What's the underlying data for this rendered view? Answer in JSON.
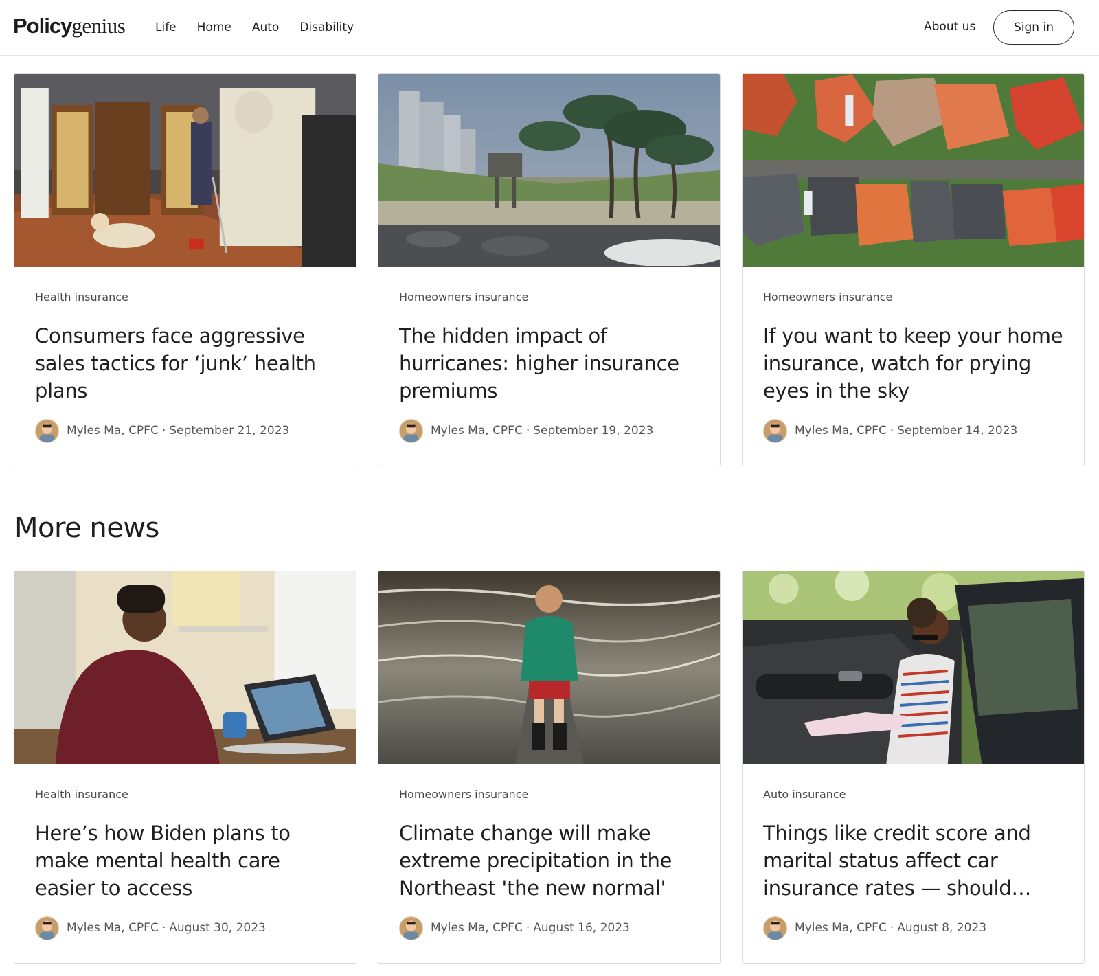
{
  "header": {
    "logo_bold": "Policy",
    "logo_light": "genius",
    "nav": [
      "Life",
      "Home",
      "Auto",
      "Disability"
    ],
    "about": "About us",
    "sign_in": "Sign in"
  },
  "top_articles": [
    {
      "category": "Health insurance",
      "title": "Consumers face aggressive sales tactics for ‘junk’ health plans",
      "author": "Myles Ma, CPFC",
      "date": "September 21, 2023",
      "image": "woman-with-crutches-in-kitchen-with-dog"
    },
    {
      "category": "Homeowners insurance",
      "title": "The hidden impact of hurricanes: higher insurance premiums",
      "author": "Myles Ma, CPFC",
      "date": "September 19, 2023",
      "image": "palm-trees-in-storm-on-beach"
    },
    {
      "category": "Homeowners insurance",
      "title": "If you want to keep your home insurance, watch for prying eyes in the sky",
      "author": "Myles Ma, CPFC",
      "date": "September 14, 2023",
      "image": "aerial-view-of-house-roofs"
    }
  ],
  "more_news": {
    "heading": "More news",
    "articles": [
      {
        "category": "Health insurance",
        "title": "Here’s how Biden plans to make mental health care easier to access",
        "author": "Myles Ma, CPFC",
        "date": "August 30, 2023",
        "image": "woman-on-video-call-with-laptop"
      },
      {
        "category": "Homeowners insurance",
        "title": "Climate change will make extreme precipitation in the Northeast 'the new normal'",
        "author": "Myles Ma, CPFC",
        "date": "August 16, 2023",
        "image": "child-standing-in-flooded-road"
      },
      {
        "category": "Auto insurance",
        "title": "Things like credit score and marital status affect car insurance rates — should that…",
        "author": "Myles Ma, CPFC",
        "date": "August 8, 2023",
        "image": "woman-getting-out-of-car"
      }
    ]
  },
  "colors": {
    "text": "#1f1f1f",
    "muted": "#555555",
    "border": "#dcdcdc"
  }
}
